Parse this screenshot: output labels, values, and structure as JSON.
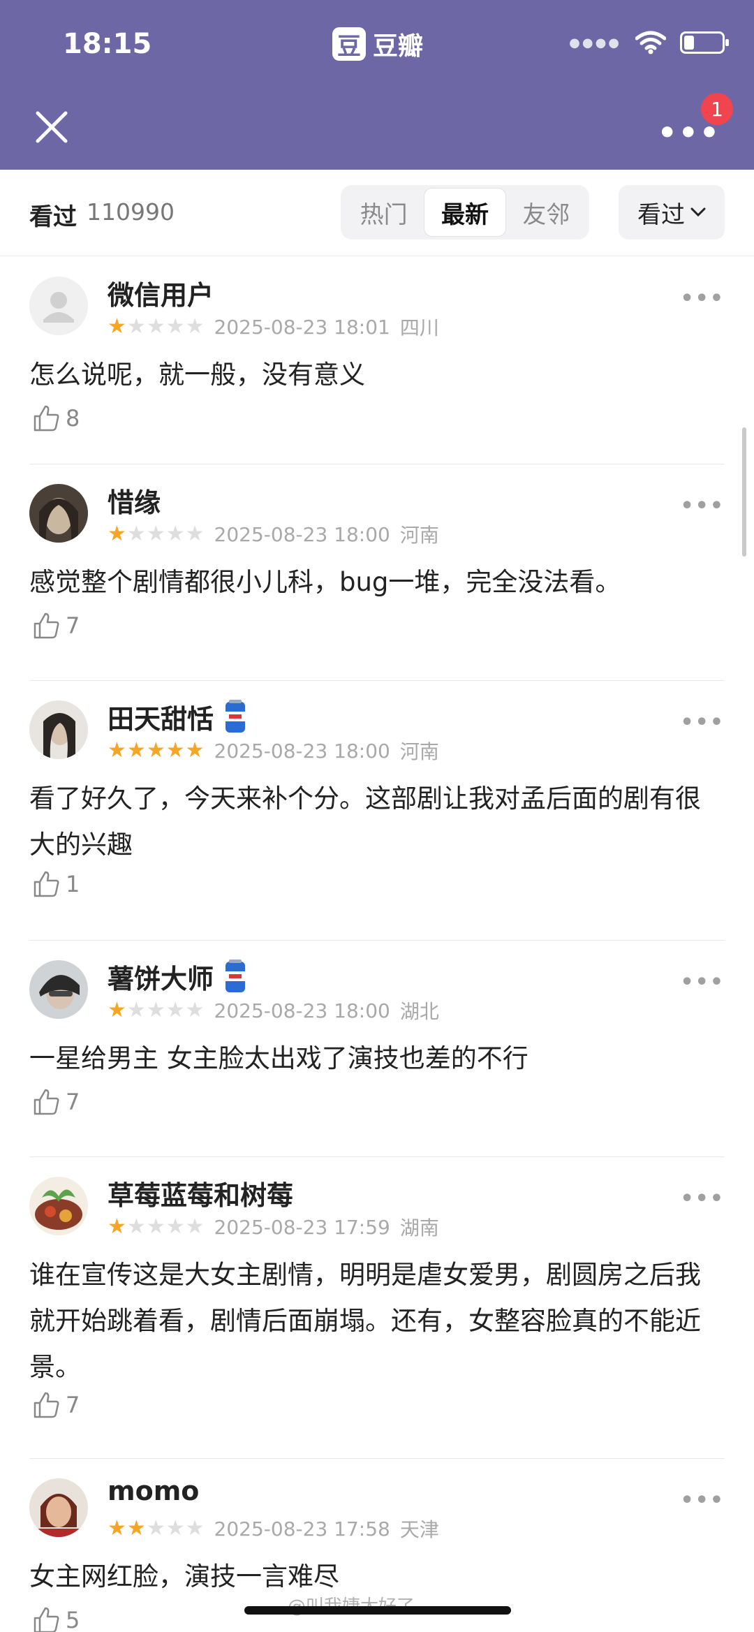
{
  "status": {
    "time": "18:15",
    "brand_logo": "豆",
    "brand_name": "豆瓣"
  },
  "header": {
    "title": "",
    "notification_count": "1"
  },
  "filter": {
    "seen_label": "看过",
    "seen_count": "110990",
    "tabs": [
      "热门",
      "最新",
      "友邻"
    ],
    "active_tab": "最新",
    "dropdown_label": "看过"
  },
  "comments": [
    {
      "user": "微信用户",
      "rating": 1,
      "time": "2025-08-23 18:01",
      "location": "四川",
      "text": "怎么说呢，就一般，没有意义",
      "likes": "8",
      "badge": false
    },
    {
      "user": "惜缘",
      "rating": 1,
      "time": "2025-08-23 18:00",
      "location": "河南",
      "text": "感觉整个剧情都很小儿科，bug一堆，完全没法看。",
      "likes": "7",
      "badge": false
    },
    {
      "user": "田天甜恬",
      "rating": 5,
      "time": "2025-08-23 18:00",
      "location": "河南",
      "text": "看了好久了，今天来补个分。这部剧让我对孟后面的剧有很大的兴趣",
      "likes": "1",
      "badge": true
    },
    {
      "user": "薯饼大师",
      "rating": 1,
      "time": "2025-08-23 18:00",
      "location": "湖北",
      "text": "一星给男主  女主脸太出戏了演技也差的不行",
      "likes": "7",
      "badge": true
    },
    {
      "user": "草莓蓝莓和树莓",
      "rating": 1,
      "time": "2025-08-23 17:59",
      "location": "湖南",
      "text": "谁在宣传这是大女主剧情，明明是虐女爱男，剧圆房之后我就开始跳着看，剧情后面崩塌。还有，女整容脸真的不能近景。",
      "likes": "7",
      "badge": false
    },
    {
      "user": "momo",
      "rating": 2,
      "time": "2025-08-23 17:58",
      "location": "天津",
      "text": "女主网红脸，演技一言难尽",
      "likes": "5",
      "badge": false
    }
  ],
  "watermark": "@叫我婕太好了",
  "colors": {
    "header_bg": "#6d67a6",
    "star_on": "#f5a623",
    "badge_red": "#f0454f"
  }
}
